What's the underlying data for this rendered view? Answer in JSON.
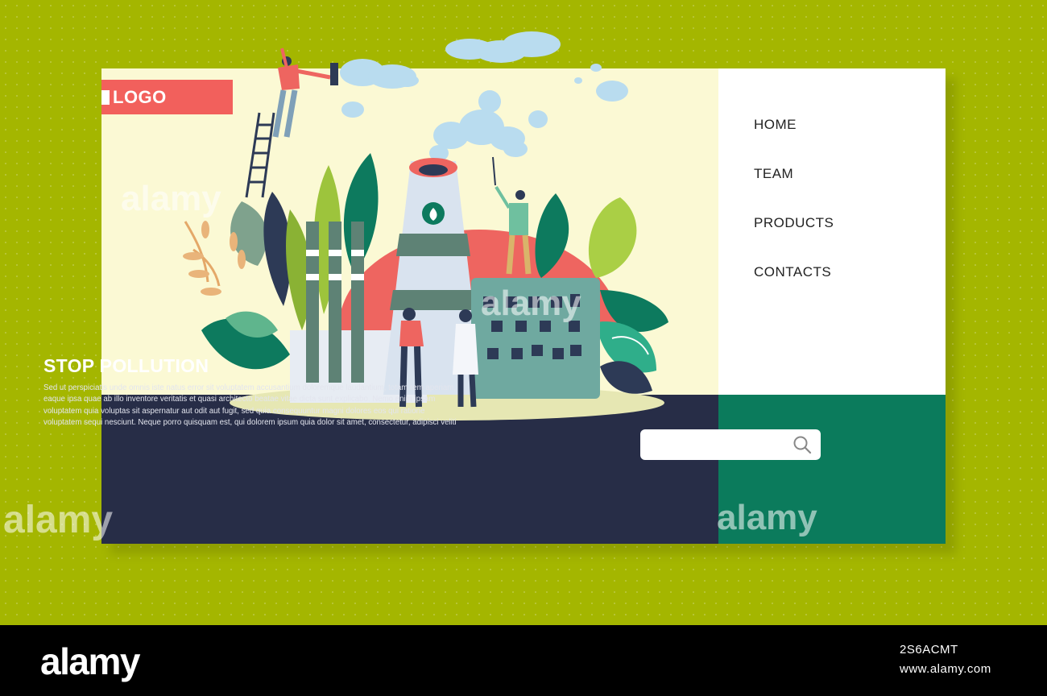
{
  "brand": {
    "logo_text": "LOGO"
  },
  "nav": {
    "items": [
      {
        "label": "HOME"
      },
      {
        "label": "TEAM"
      },
      {
        "label": "PRODUCTS"
      },
      {
        "label": "CONTACTS"
      }
    ]
  },
  "hero": {
    "title": "STOP POLLUTION",
    "body": "Sed ut perspiciatis unde omnis iste natus error sit voluptatem accusantium doloremque laudantium, totam rem aperiam, eaque ipsa quae ab illo inventore veritatis et quasi architecto beatae vitae dicta sunt explicabo. Nemo enim ipsam voluptatem quia voluptas sit aspernatur aut odit aut fugit, sed quia consequuntur magni dolores eos qui ratione voluptatem sequi nesciunt. Neque porro quisquam est, qui dolorem ipsum quia dolor sit amet, consectetur, adipisci veliti"
  },
  "search": {
    "value": "",
    "placeholder": "",
    "icon": "search-icon"
  },
  "watermark": {
    "text": "alamy"
  },
  "footer": {
    "logo": "alamy",
    "image_id": "2S6ACMT",
    "url": "www.alamy.com"
  },
  "colors": {
    "page_bg": "#a4b600",
    "hero_bg": "#fbf9d4",
    "text_panel": "#272d47",
    "search_panel": "#0b7b5c",
    "logo_accent": "#f2605c"
  }
}
